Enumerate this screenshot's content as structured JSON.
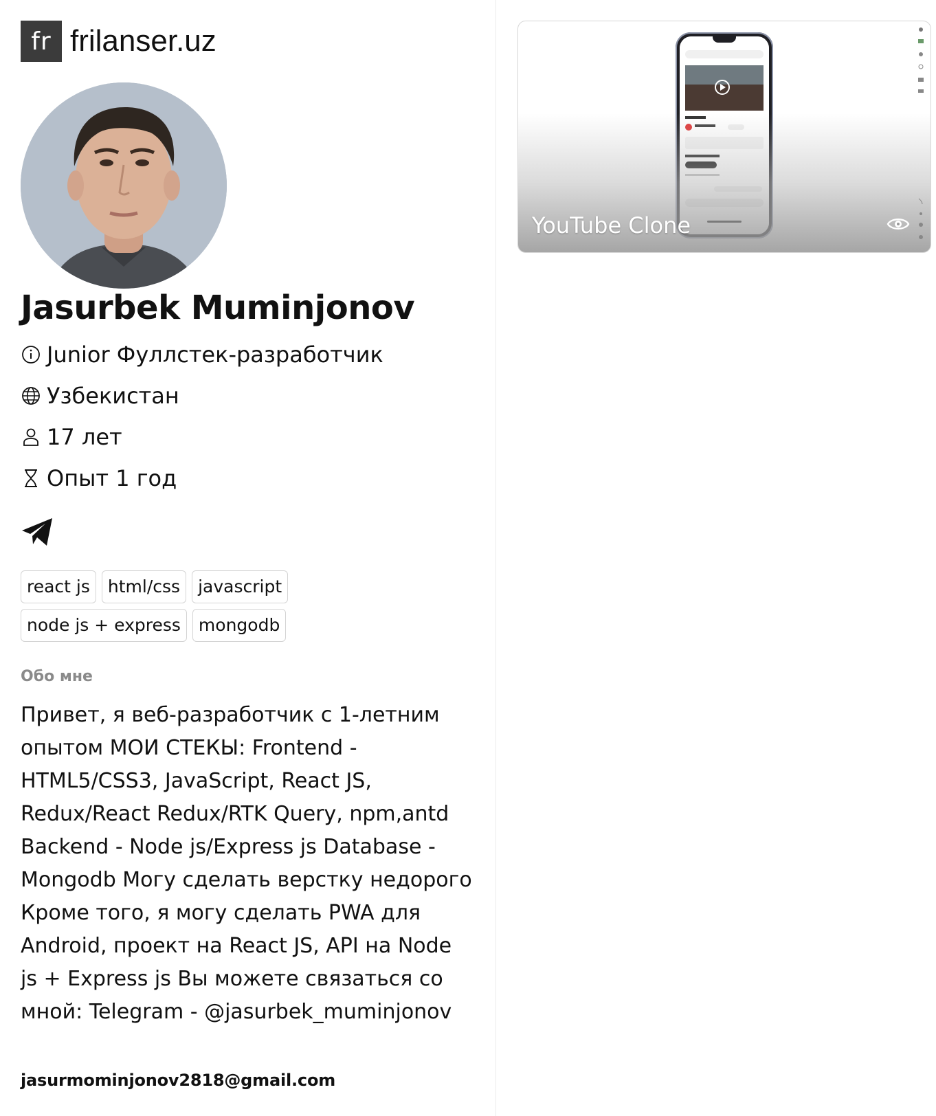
{
  "brand": {
    "mark": "fr",
    "name": "frilanser.uz"
  },
  "profile": {
    "name": "Jasurbek Muminjonov",
    "title": "Junior Фуллстек-разработчик",
    "country": "Узбекистан",
    "age": "17 лет",
    "experience": "Опыт 1 год",
    "skills": [
      "react js",
      "html/css",
      "javascript",
      "node js + express",
      "mongodb"
    ],
    "about_label": "Обо мне",
    "about": "Привет, я веб-разработчик с 1-летним опытом МОИ СТЕКЫ: Frontend - HTML5/CSS3, JavaScript, React JS, Redux/React Redux/RTK Query, npm,antd Backend - Node js/Express js Database - Mongodb Могу сделать верстку недорого Кроме того, я могу сделать PWA для Android, проект на React JS, API на Node js + Express js Вы можете связаться со мной: Telegram - @jasurbek_muminjonov",
    "email": "jasurmominjonov2818@gmail.com"
  },
  "projects": [
    {
      "title": "YouTube Clone"
    }
  ],
  "icons": {
    "title": "info-icon",
    "country": "globe-icon",
    "age": "user-icon",
    "experience": "hourglass-icon",
    "contact": "telegram-icon",
    "project_view": "eye-icon"
  }
}
